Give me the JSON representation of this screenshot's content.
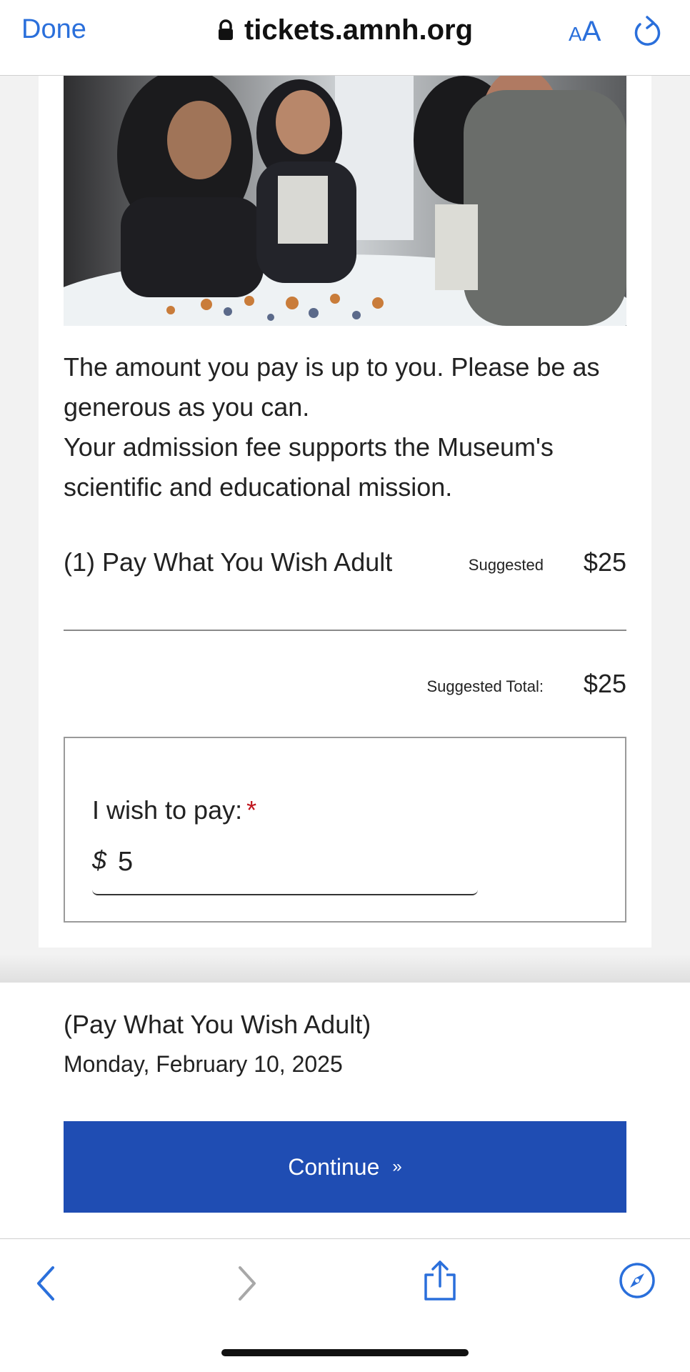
{
  "topbar": {
    "done_label": "Done",
    "url": "tickets.amnh.org",
    "text_size_small": "A",
    "text_size_large": "A"
  },
  "intro": {
    "line1": "The amount you pay is up to you. Please be as generous as you can.",
    "line2": "Your admission fee supports the Museum's scientific and educational mission."
  },
  "line_item": {
    "name": "(1) Pay What You Wish Adult",
    "suggested_label": "Suggested",
    "price": "$25"
  },
  "total": {
    "label": "Suggested Total:",
    "price": "$25"
  },
  "pay": {
    "label": "I wish to pay:",
    "required_mark": "*",
    "currency": "$",
    "amount": "5"
  },
  "summary": {
    "title": "(Pay What You Wish Adult)",
    "date": "Monday, February 10, 2025",
    "continue_label": "Continue",
    "continue_chevron": "»"
  },
  "colors": {
    "accent": "#2a6fdb",
    "button": "#1f4db3",
    "required": "#c0161e"
  },
  "icons": {
    "lock": "lock-icon",
    "reload": "reload-icon",
    "back": "back-arrow-icon",
    "forward": "forward-arrow-icon",
    "share": "share-icon",
    "safari": "safari-compass-icon"
  }
}
